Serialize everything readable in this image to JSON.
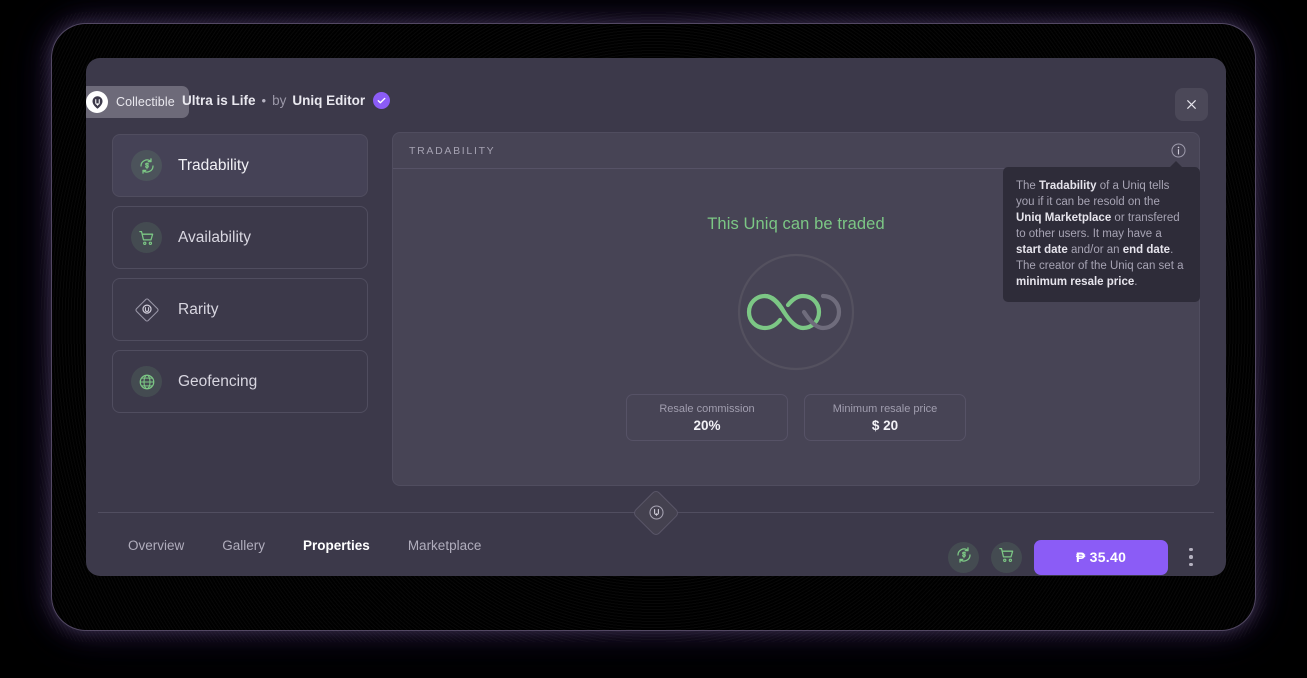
{
  "header": {
    "badge_label": "Collectible",
    "badge_icon": "ultra-logo-icon",
    "uniq_name": "Ultra is Life",
    "separator": "•",
    "by_label": "by",
    "author": "Uniq Editor",
    "verified_icon": "verified-check-icon",
    "close_icon": "close-icon"
  },
  "sidebar": {
    "items": [
      {
        "label": "Tradability",
        "icon": "trade-dollar-icon",
        "active": true
      },
      {
        "label": "Availability",
        "icon": "shopping-cart-icon",
        "active": false
      },
      {
        "label": "Rarity",
        "icon": "rarity-diamond-icon",
        "active": false
      },
      {
        "label": "Geofencing",
        "icon": "globe-icon",
        "active": false
      }
    ]
  },
  "panel": {
    "title": "TRADABILITY",
    "info_icon": "info-circle-icon",
    "status_text": "This Uniq can be traded",
    "graphic_icon": "infinity-icon",
    "stats": [
      {
        "label": "Resale commission",
        "value": "20%"
      },
      {
        "label": "Minimum resale price",
        "value": "$ 20"
      }
    ]
  },
  "tooltip": {
    "segments": [
      {
        "text": "The ",
        "bold": false
      },
      {
        "text": "Tradability",
        "bold": true
      },
      {
        "text": " of a Uniq tells you if it can be resold on the ",
        "bold": false
      },
      {
        "text": "Uniq Marketplace",
        "bold": true
      },
      {
        "text": " or transfered to other users. It may have a ",
        "bold": false
      },
      {
        "text": "start date",
        "bold": true
      },
      {
        "text": " and/or an ",
        "bold": false
      },
      {
        "text": "end date",
        "bold": true
      },
      {
        "text": ".",
        "bold": false
      }
    ],
    "line2_segments": [
      {
        "text": "The creator of the Uniq can set a ",
        "bold": false
      },
      {
        "text": "minimum resale price",
        "bold": true
      },
      {
        "text": ".",
        "bold": false
      }
    ]
  },
  "divider": {
    "icon": "ultra-diamond-logo-icon"
  },
  "footer": {
    "tabs": [
      {
        "label": "Overview",
        "active": false
      },
      {
        "label": "Gallery",
        "active": false
      },
      {
        "label": "Properties",
        "active": true
      },
      {
        "label": "Marketplace",
        "active": false
      }
    ],
    "actions": {
      "trade_icon": "trade-dollar-icon",
      "cart_icon": "shopping-cart-icon",
      "price_label": "₱ 35.40",
      "kebab_icon": "more-vertical-icon"
    }
  },
  "colors": {
    "accent_purple": "#8b5cf6",
    "accent_green": "#7cc785",
    "modal_bg": "#3c394a",
    "panel_bg": "#474455",
    "tooltip_bg": "#2e2c39"
  }
}
